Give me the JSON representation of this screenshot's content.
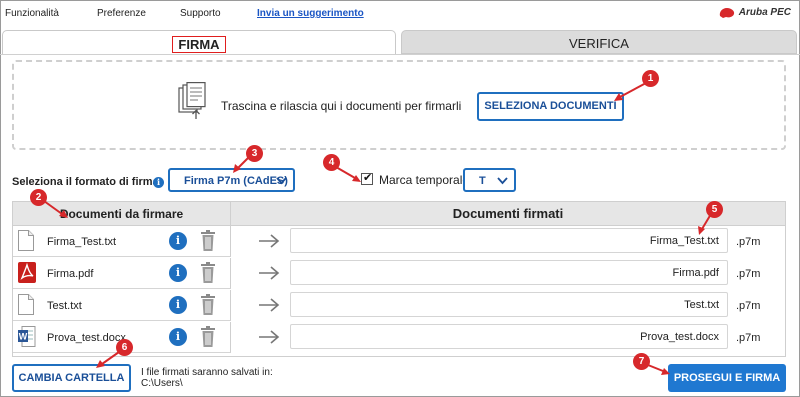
{
  "menu": {
    "items": [
      "Funzionalità",
      "Preferenze",
      "Supporto"
    ],
    "link": "Invia un suggerimento"
  },
  "logo": {
    "text": "Aruba PEC",
    "color": "#d7282b"
  },
  "tabs": [
    {
      "label": "FIRMA",
      "active": true
    },
    {
      "label": "VERIFICA",
      "active": false
    }
  ],
  "dropzone": {
    "text": "Trascina e rilascia qui i documenti per firmarli",
    "button": "SELEZIONA DOCUMENTI",
    "icon": "documents-icon"
  },
  "format": {
    "label": "Seleziona il formato di firma",
    "info_icon": "info-icon",
    "selected": "Firma P7m (CAdES)"
  },
  "timestamp": {
    "label": "Marca temporale",
    "checked": true,
    "selected": "T"
  },
  "table": {
    "header_left": "Documenti da firmare",
    "header_right": "Documenti firmati",
    "rows": [
      {
        "name": "Firma_Test.txt",
        "type": "txt",
        "signed": "Firma_Test.txt",
        "ext": ".p7m"
      },
      {
        "name": "Firma.pdf",
        "type": "pdf",
        "signed": "Firma.pdf",
        "ext": ".p7m"
      },
      {
        "name": "Test.txt",
        "type": "txt",
        "signed": "Test.txt",
        "ext": ".p7m"
      },
      {
        "name": "Prova_test.docx",
        "type": "docx",
        "signed": "Prova_test.docx",
        "ext": ".p7m"
      }
    ]
  },
  "footer": {
    "change_folder": "CAMBIA CARTELLA",
    "save_line1": "I file firmati saranno salvati in:",
    "save_line2": "C:\\Users\\",
    "proceed": "PROSEGUI E FIRMA"
  },
  "badges": [
    "1",
    "2",
    "3",
    "4",
    "5",
    "6",
    "7"
  ],
  "colors": {
    "accent": "#1f6fbf",
    "primary_button": "#1f78d1",
    "badge": "#d7282b",
    "tab_inactive": "#dcdcdc"
  }
}
